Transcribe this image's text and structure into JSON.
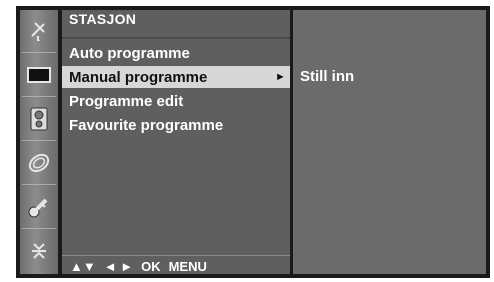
{
  "menu": {
    "title": "STASJON",
    "items": [
      {
        "label": "Auto programme",
        "selected": false
      },
      {
        "label": "Manual programme",
        "selected": true
      },
      {
        "label": "Programme edit",
        "selected": false
      },
      {
        "label": "Favourite programme",
        "selected": false
      }
    ],
    "selected_arrow": "►"
  },
  "submenu": {
    "label": "Still inn"
  },
  "footer": {
    "up_down": "▲▼",
    "left_right": "◄ ►",
    "ok": "OK",
    "menu": "MENU"
  },
  "left_rail": {
    "icons": [
      "antenna-icon",
      "picture-icon",
      "speaker-icon",
      "clock-icon",
      "key-icon",
      "plug-icon"
    ]
  },
  "colors": {
    "menu_bg": "#5f5f5f",
    "selected_bg": "#d7d7d7",
    "right_bg": "#6b6b6b",
    "text": "#ffffff"
  }
}
